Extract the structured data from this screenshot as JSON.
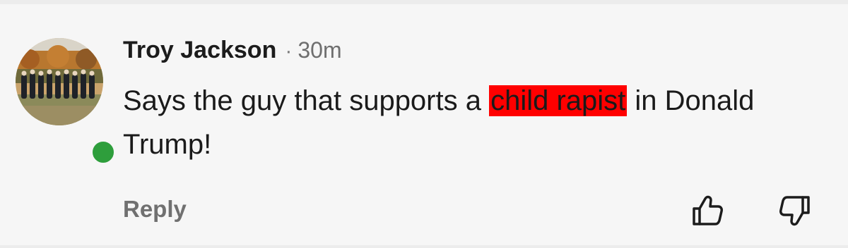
{
  "comment": {
    "author": "Troy Jackson",
    "separator": "·",
    "timestamp": "30m",
    "text_before": "Says the guy that supports a ",
    "text_highlight": "child rapist",
    "text_after": " in Donald Trump!",
    "highlight_color": "#ff0000",
    "online_status": "online",
    "online_color": "#2e9e3c"
  },
  "actions": {
    "reply_label": "Reply",
    "upvote_icon": "thumbs-up-icon",
    "downvote_icon": "thumbs-down-icon"
  }
}
